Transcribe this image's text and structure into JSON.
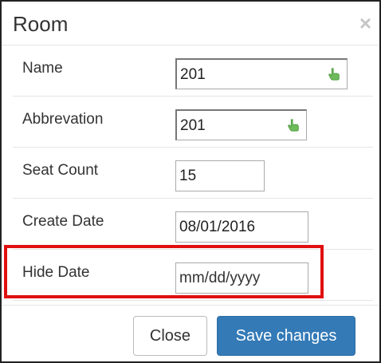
{
  "dialog": {
    "title": "Room",
    "close_glyph": "×"
  },
  "form": {
    "name": {
      "label": "Name",
      "value": "201"
    },
    "abbreviation": {
      "label": "Abbrevation",
      "value": "201"
    },
    "seat_count": {
      "label": "Seat Count",
      "value": "15"
    },
    "create_date": {
      "label": "Create Date",
      "value": "08/01/2016"
    },
    "hide_date": {
      "label": "Hide Date",
      "placeholder": "mm/dd/yyyy",
      "highlighted": true
    }
  },
  "footer": {
    "close_label": "Close",
    "save_label": "Save changes"
  },
  "icons": {
    "autofill": "pointing-hand-icon"
  },
  "colors": {
    "primary": "#337ab7",
    "highlight": "#e01010",
    "autofill_hand": "#6dbb5b"
  }
}
